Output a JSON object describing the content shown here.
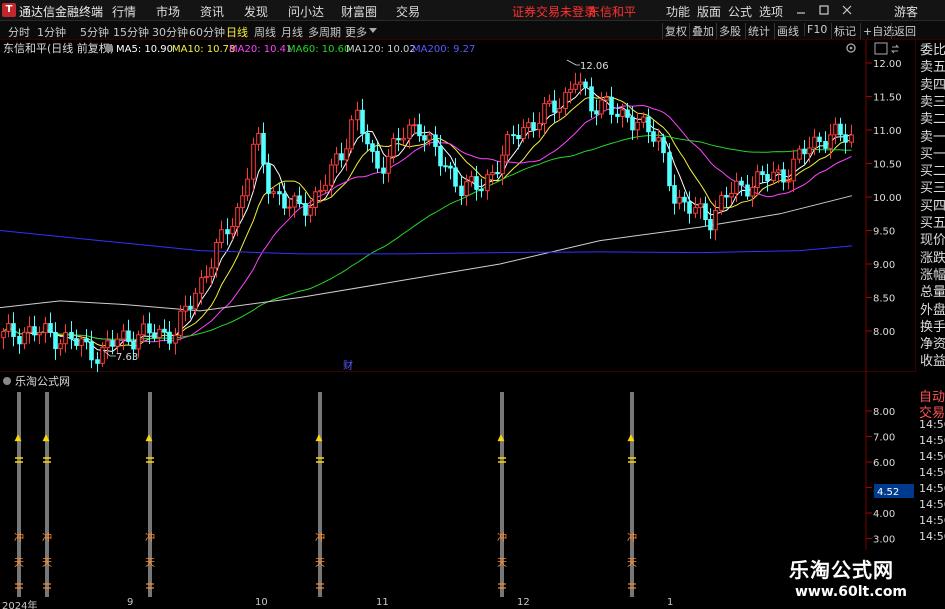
{
  "menubar": {
    "app_title": "通达信金融终端",
    "logo": "T",
    "items": [
      "行情",
      "市场",
      "资讯",
      "发现",
      "问小达",
      "财富圈",
      "交易"
    ],
    "notice": "证券交易未登录",
    "stock": "东信和平",
    "right_items": [
      "功能",
      "版面",
      "公式",
      "选项"
    ],
    "guest": "游客"
  },
  "toolbar": {
    "periods": [
      "分时",
      "1分钟",
      "5分钟",
      "15分钟",
      "30分钟",
      "60分钟",
      "日线",
      "周线",
      "月线",
      "多周期",
      "更多"
    ],
    "active_period": "日线",
    "right_buttons": [
      "复权",
      "叠加",
      "多股",
      "统计",
      "画线",
      "F10",
      "标记",
      "+自选",
      "返回"
    ]
  },
  "ma_legend": {
    "title": "东信和平(日线 前复权)",
    "ma5": "MA5: 10.90",
    "ma10": "MA10: 10.78",
    "ma20": "MA20: 10.41",
    "ma60": "MA60: 10.60",
    "ma120": "MA120: 10.02",
    "ma200": "MA200: 9.27"
  },
  "annotations": {
    "high": "12.06",
    "low": "7.63",
    "finance_marker": "财"
  },
  "price_axis": [
    "12.00",
    "11.50",
    "11.00",
    "10.50",
    "10.00",
    "9.50",
    "9.00",
    "8.50",
    "8.00"
  ],
  "side_panel": [
    "委比",
    "卖五",
    "卖四",
    "卖三",
    "卖二",
    "卖一",
    "买一",
    "买二",
    "买三",
    "买四",
    "买五",
    "现价",
    "涨跌",
    "涨幅",
    "总量",
    "外盘",
    "换手",
    "净资",
    "收益"
  ],
  "side_panel2": [
    "自动",
    "交易",
    "14:56",
    "14:56",
    "14:56",
    "14:56",
    "14:56",
    "14:56",
    "14:56",
    "14:56"
  ],
  "indicator": {
    "title": "乐淘公式网",
    "axis": [
      "8.00",
      "7.00",
      "6.00",
      "5.00",
      "4.00",
      "3.00"
    ],
    "value": "4.52",
    "mark_1": "冲",
    "mark_2": "天",
    "signal_up": "▲"
  },
  "date_axis": [
    "2024年",
    "9",
    "10",
    "11",
    "12",
    "1"
  ],
  "watermark": {
    "line1": "乐淘公式网",
    "line2": "www.60lt.com"
  },
  "colors": {
    "up": "#ff3b3b",
    "down": "#54ffff",
    "ma5": "#ffffff",
    "ma10": "#f6f03a",
    "ma20": "#ff44ff",
    "ma60": "#27d627",
    "ma120": "#cfcfcf",
    "ma200": "#3232ff",
    "signal": "#ffd700",
    "bar": "#777777"
  }
}
